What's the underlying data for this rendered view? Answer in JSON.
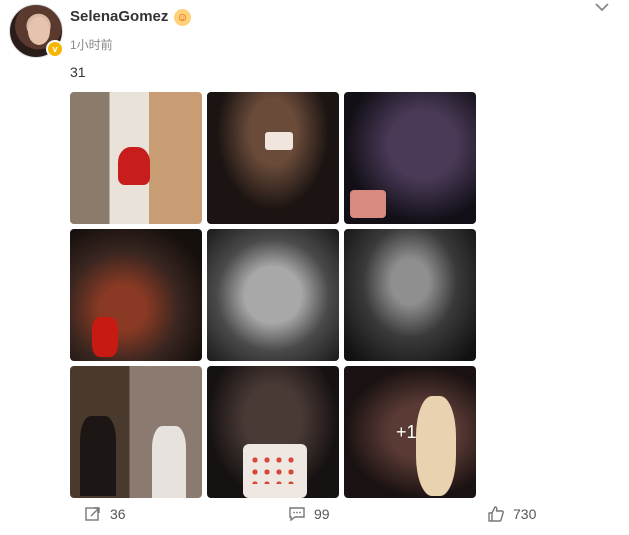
{
  "post": {
    "username": "SelenaGomez",
    "time": "1小时前",
    "text": "31",
    "more_count": "+1"
  },
  "photos": [
    {
      "id": "photo-1"
    },
    {
      "id": "photo-2"
    },
    {
      "id": "photo-3"
    },
    {
      "id": "photo-4"
    },
    {
      "id": "photo-5"
    },
    {
      "id": "photo-6"
    },
    {
      "id": "photo-7"
    },
    {
      "id": "photo-8"
    },
    {
      "id": "photo-9"
    }
  ],
  "footer": {
    "share_count": "36",
    "comment_count": "99",
    "like_count": "730"
  },
  "icons": {
    "share": "share-icon",
    "comment": "comment-icon",
    "like": "thumbs-up-icon",
    "menu": "chevron-down-icon",
    "verified": "verified-badge-icon"
  },
  "colors": {
    "verified": "#f7b500",
    "text": "#333333",
    "muted": "#888888"
  }
}
